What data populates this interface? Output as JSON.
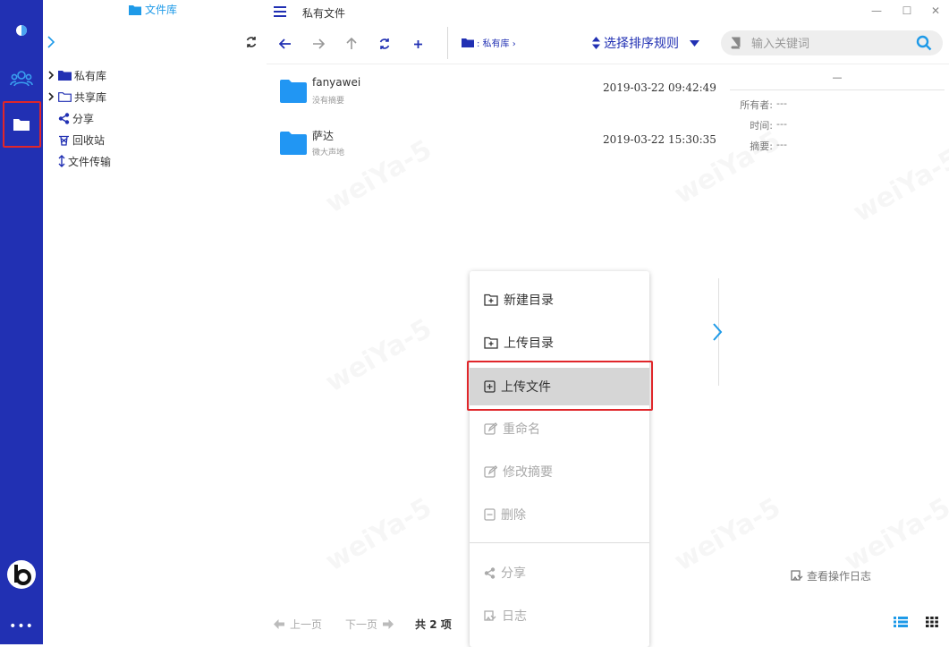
{
  "rail": {
    "items": [
      {
        "name": "logo-icon"
      },
      {
        "name": "users-icon"
      },
      {
        "name": "folder-icon"
      }
    ],
    "more_label": "•••"
  },
  "tree": {
    "title": "文件库",
    "nodes": [
      {
        "label": "私有库",
        "icon": "folder-filled-icon",
        "expandable": true
      },
      {
        "label": "共享库",
        "icon": "folder-outline-icon",
        "expandable": true
      },
      {
        "label": "分享",
        "icon": "share-icon",
        "expandable": false
      },
      {
        "label": "回收站",
        "icon": "trash-icon",
        "expandable": false
      },
      {
        "label": "文件传输",
        "icon": "transfer-icon",
        "expandable": false
      }
    ]
  },
  "window": {
    "title": "私有文件",
    "controls": {
      "minimize": "—",
      "maximize": "☐",
      "close": "✕"
    }
  },
  "toolbar": {
    "breadcrumb": ": 私有库 ›",
    "sort_label": "选择排序规则",
    "search_placeholder": "输入关键词"
  },
  "files": [
    {
      "name": "fanyawei",
      "summary": "没有摘要",
      "date": "2019-03-22 09:42:49"
    },
    {
      "name": "萨达",
      "summary": "微大声地",
      "date": "2019-03-22 15:30:35"
    }
  ],
  "details": {
    "heading": "—",
    "rows": [
      {
        "label": "所有者:",
        "value": "---"
      },
      {
        "label": "时间:",
        "value": "---"
      },
      {
        "label": "摘要:",
        "value": "---"
      }
    ]
  },
  "log_button": "查看操作日志",
  "pager": {
    "prev": "上一页",
    "next": "下一页",
    "total": "共 2 项"
  },
  "context_menu": {
    "items": [
      {
        "label": "新建目录",
        "icon": "folder-plus-icon",
        "enabled": true
      },
      {
        "label": "上传目录",
        "icon": "folder-upload-icon",
        "enabled": true
      },
      {
        "label": "上传文件",
        "icon": "file-upload-icon",
        "enabled": true,
        "active": true
      },
      {
        "label": "重命名",
        "icon": "edit-icon",
        "enabled": false
      },
      {
        "label": "修改摘要",
        "icon": "edit-icon",
        "enabled": false
      },
      {
        "label": "删除",
        "icon": "delete-icon",
        "enabled": false
      },
      {
        "label": "分享",
        "icon": "share-icon",
        "enabled": false
      },
      {
        "label": "日志",
        "icon": "log-icon",
        "enabled": false
      }
    ]
  },
  "watermark": "weiYa-5",
  "colors": {
    "rail": "#2130b3",
    "accent": "#1e9ae8",
    "highlight": "#e0262a"
  }
}
